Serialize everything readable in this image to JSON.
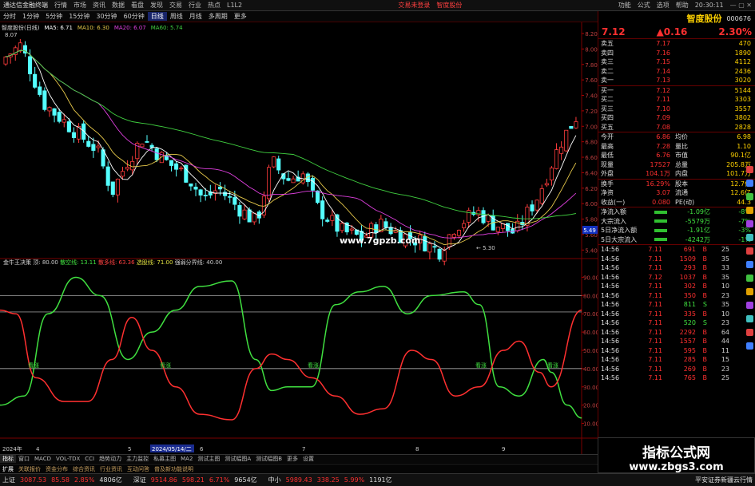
{
  "menu": {
    "app": "通达信金融终端",
    "items": [
      "行情",
      "市场",
      "资讯",
      "数据",
      "看盘",
      "发现",
      "交易",
      "行业",
      "热点",
      "L1L2"
    ],
    "center": [
      "交易未登录",
      "智度股份"
    ],
    "right": [
      "功能",
      "公式",
      "选项",
      "帮助"
    ],
    "time": "20:30:11"
  },
  "subbar": {
    "periods": [
      "分时",
      "1分钟",
      "5分钟",
      "15分钟",
      "30分钟",
      "60分钟",
      "日线",
      "周线",
      "月线",
      "多周期",
      "更多"
    ],
    "active": "日线",
    "tools": [
      "复权",
      "叠加",
      "统计",
      "画线",
      "F10",
      "标记",
      "自选",
      "返回"
    ]
  },
  "price_chart": {
    "title": "智度股份(日线)",
    "ma": [
      {
        "label": "MA5: 6.71",
        "color": "#ffffff"
      },
      {
        "label": "MA10: 6.30",
        "color": "#e6c84a"
      },
      {
        "label": "MA20: 6.07",
        "color": "#e040e0"
      },
      {
        "label": "MA60: 5.74",
        "color": "#40d040"
      }
    ],
    "high_label": "8.07",
    "low_label": "5.30",
    "website": "www.7gpzb.com",
    "current_tag": "5.49",
    "yaxis": [
      "8.20",
      "8.00",
      "7.80",
      "7.60",
      "7.40",
      "7.20",
      "7.00",
      "6.80",
      "6.60",
      "6.40",
      "6.20",
      "6.00",
      "5.80",
      "5.60",
      "5.40"
    ]
  },
  "indicator": {
    "name": "金牛王决策",
    "items": [
      {
        "label": "顶: 80.00",
        "color": "#cccccc"
      },
      {
        "label": "散空线: 13.11",
        "color": "#40e040"
      },
      {
        "label": "散多线: 63.36",
        "color": "#ff4040"
      },
      {
        "label": "选股线: 71.00",
        "color": "#e0e040"
      },
      {
        "label": "强弱分界线: 40.00",
        "color": "#cccccc"
      }
    ],
    "yaxis": [
      "90.00",
      "80.00",
      "70.00",
      "60.00",
      "50.00",
      "40.00",
      "30.00",
      "20.00",
      "10.00"
    ],
    "bq_label": "看涨"
  },
  "date_axis": {
    "labels": [
      "2024年",
      "4",
      "5",
      "6",
      "7",
      "8",
      "9"
    ],
    "cursor": "2024/05/14/二"
  },
  "bottom_tabs": [
    "指标",
    "窗口",
    "MACD",
    "VOL-TDX",
    "CCI",
    "趋势动力",
    "主力监控",
    "私募主图",
    "MA2",
    "测试主图",
    "测试幅图A",
    "测试幅图B",
    "更多",
    "设置"
  ],
  "stock": {
    "name": "智度股份",
    "code": "000676",
    "price": "7.12",
    "change": "0.16",
    "pct": "2.30%"
  },
  "orderbook": {
    "sell": [
      {
        "label": "卖五",
        "price": "7.17",
        "vol": "470"
      },
      {
        "label": "卖四",
        "price": "7.16",
        "vol": "1890"
      },
      {
        "label": "卖三",
        "price": "7.15",
        "vol": "4112"
      },
      {
        "label": "卖二",
        "price": "7.14",
        "vol": "2436"
      },
      {
        "label": "卖一",
        "price": "7.13",
        "vol": "3020"
      }
    ],
    "buy": [
      {
        "label": "买一",
        "price": "7.12",
        "vol": "5144"
      },
      {
        "label": "买二",
        "price": "7.11",
        "vol": "3303"
      },
      {
        "label": "买三",
        "price": "7.10",
        "vol": "3557"
      },
      {
        "label": "买四",
        "price": "7.09",
        "vol": "3802"
      },
      {
        "label": "买五",
        "price": "7.08",
        "vol": "2828"
      }
    ]
  },
  "stats": [
    {
      "k1": "今开",
      "v1": "6.86",
      "k2": "均价",
      "v2": "6.98"
    },
    {
      "k1": "最高",
      "v1": "7.28",
      "k2": "量比",
      "v2": "1.10"
    },
    {
      "k1": "最低",
      "v1": "6.76",
      "k2": "市值",
      "v2": "90.1亿"
    },
    {
      "k1": "现量",
      "v1": "17527",
      "k2": "总量",
      "v2": "205.8万"
    },
    {
      "k1": "外盘",
      "v1": "104.1万",
      "k2": "内盘",
      "v2": "101.7万"
    }
  ],
  "stats2": [
    {
      "k1": "换手",
      "v1": "16.29%",
      "k2": "股本",
      "v2": "12.7亿"
    },
    {
      "k1": "净资",
      "v1": "3.07",
      "k2": "流通",
      "v2": "12.6亿"
    },
    {
      "k1": "收益(一)",
      "v1": "0.080",
      "k2": "PE(动)",
      "v2": "44.3"
    }
  ],
  "flows": [
    {
      "label": "净流入额",
      "value": "-1.09亿",
      "pct": "-8%"
    },
    {
      "label": "大宗流入",
      "value": "-5579万",
      "pct": "-7%"
    },
    {
      "label": "5日净流入额",
      "value": "-1.91亿",
      "pct": "-3%"
    },
    {
      "label": "5日大宗流入",
      "value": "-4242万",
      "pct": "-1%"
    }
  ],
  "ticks": [
    {
      "time": "14:56",
      "price": "7.11",
      "vol": "691",
      "bs": "B",
      "num": "25"
    },
    {
      "time": "14:56",
      "price": "7.11",
      "vol": "1509",
      "bs": "B",
      "num": "35"
    },
    {
      "time": "14:56",
      "price": "7.11",
      "vol": "293",
      "bs": "B",
      "num": "33"
    },
    {
      "time": "14:56",
      "price": "7.12",
      "vol": "1037",
      "bs": "B",
      "num": "35"
    },
    {
      "time": "14:56",
      "price": "7.11",
      "vol": "302",
      "bs": "B",
      "num": "10"
    },
    {
      "time": "14:56",
      "price": "7.11",
      "vol": "350",
      "bs": "B",
      "num": "23"
    },
    {
      "time": "14:56",
      "price": "7.11",
      "vol": "811",
      "bs": "S",
      "num": "35"
    },
    {
      "time": "14:56",
      "price": "7.11",
      "vol": "335",
      "bs": "B",
      "num": "10"
    },
    {
      "time": "14:56",
      "price": "7.11",
      "vol": "520",
      "bs": "S",
      "num": "23"
    },
    {
      "time": "14:56",
      "price": "7.11",
      "vol": "2292",
      "bs": "B",
      "num": "64"
    },
    {
      "time": "14:56",
      "price": "7.11",
      "vol": "1557",
      "bs": "B",
      "num": "44"
    },
    {
      "time": "14:56",
      "price": "7.11",
      "vol": "595",
      "bs": "B",
      "num": "11"
    },
    {
      "time": "14:56",
      "price": "7.11",
      "vol": "285",
      "bs": "B",
      "num": "15"
    },
    {
      "time": "14:56",
      "price": "7.11",
      "vol": "269",
      "bs": "B",
      "num": "23"
    },
    {
      "time": "14:56",
      "price": "7.11",
      "vol": "765",
      "bs": "B",
      "num": "25"
    }
  ],
  "extra_tabs": [
    "扩展",
    "关联报价",
    "资金分布",
    "综合资讯",
    "行业资讯",
    "互动问答",
    "普及新功能说明"
  ],
  "right_footer": [
    "图文F10",
    "模板"
  ],
  "status": {
    "items": [
      {
        "name": "上证",
        "value": "3087.53",
        "change": "85.58",
        "pct": "2.85%",
        "amount": "4806亿"
      },
      {
        "name": "深证",
        "value": "9514.86",
        "change": "598.21",
        "pct": "6.71%",
        "amount": "9654亿"
      },
      {
        "name": "中小",
        "value": "5989.43",
        "change": "338.25",
        "pct": "5.99%",
        "amount": "1191亿"
      }
    ],
    "right": "平安证券新疆云行情"
  },
  "watermark": {
    "title": "指标公式网",
    "url": "www.zbgs3.com"
  }
}
